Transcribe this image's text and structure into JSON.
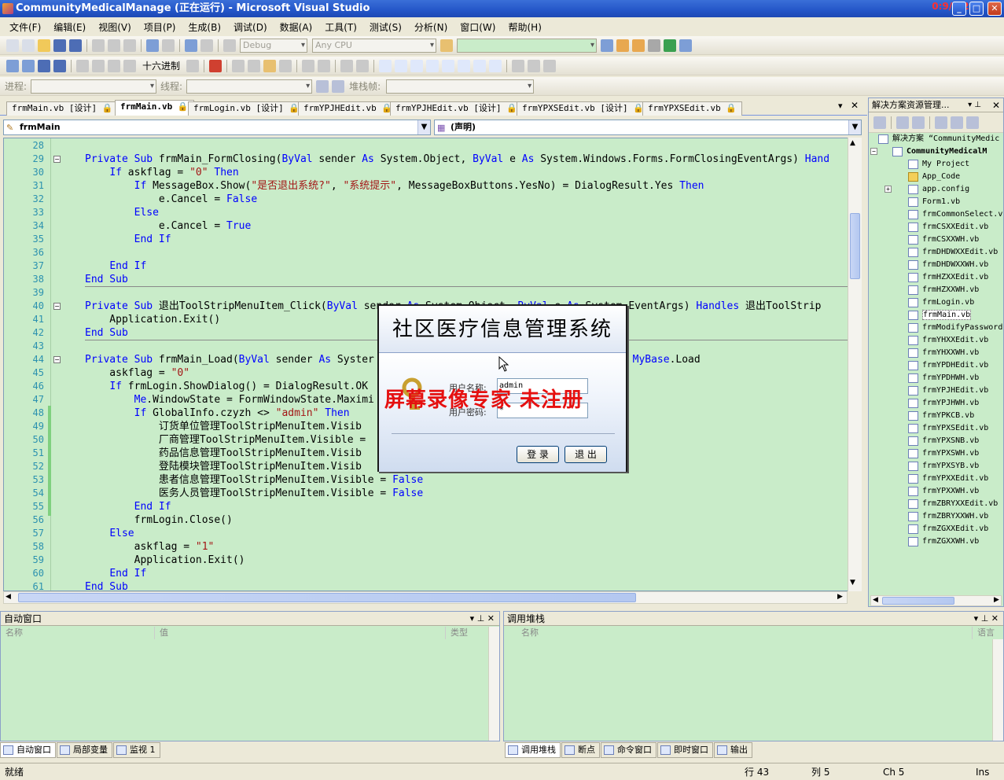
{
  "window": {
    "title": "CommunityMedicalManage (正在运行) - Microsoft Visual Studio",
    "timer": "0:9/2:29",
    "min": "_",
    "max": "□",
    "close": "✕"
  },
  "menu": [
    "文件(F)",
    "编辑(E)",
    "视图(V)",
    "项目(P)",
    "生成(B)",
    "调试(D)",
    "数据(A)",
    "工具(T)",
    "测试(S)",
    "分析(N)",
    "窗口(W)",
    "帮助(H)"
  ],
  "toolbar": {
    "config": "Debug",
    "platform": "Any CPU",
    "hex_label": "十六进制",
    "process_label": "进程:",
    "thread_label": "线程:",
    "stack_label": "堆栈帧:"
  },
  "tabs": [
    {
      "label": "frmMain.vb [设计]"
    },
    {
      "label": "frmMain.vb",
      "active": true
    },
    {
      "label": "frmLogin.vb [设计]"
    },
    {
      "label": "frmYPJHEdit.vb"
    },
    {
      "label": "frmYPJHEdit.vb [设计]"
    },
    {
      "label": "frmYPXSEdit.vb [设计]"
    },
    {
      "label": "frmYPXSEdit.vb"
    }
  ],
  "editor": {
    "class_combo": "frmMain",
    "member_combo": "(声明)",
    "lines": [
      {
        "n": "28",
        "html": ""
      },
      {
        "n": "29",
        "html": "<span class=\"kw\">Private Sub</span> frmMain_FormClosing(<span class=\"kw\">ByVal</span> sender <span class=\"kw\">As</span> System.Object, <span class=\"kw\">ByVal</span> e <span class=\"kw\">As</span> System.Windows.Forms.FormClosingEventArgs) <span class=\"kw\">Hand</span>"
      },
      {
        "n": "30",
        "html": "    <span class=\"kw\">If</span> askflag = <span class=\"str\">\"0\"</span> <span class=\"kw\">Then</span>"
      },
      {
        "n": "31",
        "html": "        <span class=\"kw\">If</span> MessageBox.Show(<span class=\"str\">\"是否退出系统?\"</span>, <span class=\"str\">\"系统提示\"</span>, MessageBoxButtons.YesNo) = DialogResult.Yes <span class=\"kw\">Then</span>"
      },
      {
        "n": "32",
        "html": "            e.Cancel = <span class=\"kw\">False</span>"
      },
      {
        "n": "33",
        "html": "        <span class=\"kw\">Else</span>"
      },
      {
        "n": "34",
        "html": "            e.Cancel = <span class=\"kw\">True</span>"
      },
      {
        "n": "35",
        "html": "        <span class=\"kw\">End If</span>"
      },
      {
        "n": "36",
        "html": ""
      },
      {
        "n": "37",
        "html": "    <span class=\"kw\">End If</span>"
      },
      {
        "n": "38",
        "html": "<span class=\"kw\">End Sub</span>"
      },
      {
        "n": "39",
        "html": ""
      },
      {
        "n": "40",
        "html": "<span class=\"kw\">Private Sub</span> 退出ToolStripMenuItem_Click(<span class=\"kw\">ByVal</span> sender <span class=\"kw\">As</span> System.Object, <span class=\"kw\">ByVal</span> e <span class=\"kw\">As</span> System.EventArgs) <span class=\"kw\">Handles</span> 退出ToolStrip"
      },
      {
        "n": "41",
        "html": "    Application.Exit()"
      },
      {
        "n": "42",
        "html": "<span class=\"kw\">End Sub</span>"
      },
      {
        "n": "43",
        "html": ""
      },
      {
        "n": "44",
        "html": "<span class=\"kw\">Private Sub</span> frmMain_Load(<span class=\"kw\">ByVal</span> sender <span class=\"kw\">As</span> Syster                                   <span class=\"kw\">andles MyBase</span>.Load"
      },
      {
        "n": "45",
        "html": "    askflag = <span class=\"str\">\"0\"</span>"
      },
      {
        "n": "46",
        "html": "    <span class=\"kw\">If</span> frmLogin.ShowDialog() = DialogResult.OK"
      },
      {
        "n": "47",
        "html": "        <span class=\"kw\">Me</span>.WindowState = FormWindowState.Maximi"
      },
      {
        "n": "48",
        "html": "        <span class=\"kw\">If</span> GlobalInfo.czyzh &lt;&gt; <span class=\"str\">\"admin\"</span> <span class=\"kw\">Then</span>"
      },
      {
        "n": "49",
        "html": "            订货单位管理ToolStripMenuItem.Visib"
      },
      {
        "n": "50",
        "html": "            厂商管理ToolStripMenuItem.Visible ="
      },
      {
        "n": "51",
        "html": "            药品信息管理ToolStripMenuItem.Visib"
      },
      {
        "n": "52",
        "html": "            登陆模块管理ToolStripMenuItem.Visib"
      },
      {
        "n": "53",
        "html": "            患者信息管理ToolStripMenuItem.Visible = <span class=\"kw\">False</span>"
      },
      {
        "n": "54",
        "html": "            医务人员管理ToolStripMenuItem.Visible = <span class=\"kw\">False</span>"
      },
      {
        "n": "55",
        "html": "        <span class=\"kw\">End If</span>"
      },
      {
        "n": "56",
        "html": "        frmLogin.Close()"
      },
      {
        "n": "57",
        "html": "    <span class=\"kw\">Else</span>"
      },
      {
        "n": "58",
        "html": "        askflag = <span class=\"str\">\"1\"</span>"
      },
      {
        "n": "59",
        "html": "        Application.Exit()"
      },
      {
        "n": "60",
        "html": "    <span class=\"kw\">End If</span>"
      },
      {
        "n": "61",
        "html": "<span class=\"kw\">End Sub</span>"
      }
    ]
  },
  "solution": {
    "title": "解决方案资源管理...",
    "items": [
      {
        "label": "解决方案 “CommunityMedic",
        "level": 0,
        "type": "solution"
      },
      {
        "label": "CommunityMedicalM",
        "level": 1,
        "type": "project",
        "bold": true
      },
      {
        "label": "My Project",
        "level": 2,
        "type": "file"
      },
      {
        "label": "App_Code",
        "level": 2,
        "type": "folder"
      },
      {
        "label": "app.config",
        "level": 2,
        "type": "file"
      },
      {
        "label": "Form1.vb",
        "level": 2,
        "type": "file"
      },
      {
        "label": "frmCommonSelect.v",
        "level": 2,
        "type": "file"
      },
      {
        "label": "frmCSXXEdit.vb",
        "level": 2,
        "type": "file"
      },
      {
        "label": "frmCSXXWH.vb",
        "level": 2,
        "type": "file"
      },
      {
        "label": "frmDHDWXXEdit.vb",
        "level": 2,
        "type": "file"
      },
      {
        "label": "frmDHDWXXWH.vb",
        "level": 2,
        "type": "file"
      },
      {
        "label": "frmHZXXEdit.vb",
        "level": 2,
        "type": "file"
      },
      {
        "label": "frmHZXXWH.vb",
        "level": 2,
        "type": "file"
      },
      {
        "label": "frmLogin.vb",
        "level": 2,
        "type": "file"
      },
      {
        "label": "frmMain.vb",
        "level": 2,
        "type": "file",
        "selected": true
      },
      {
        "label": "frmModifyPassword",
        "level": 2,
        "type": "file"
      },
      {
        "label": "frmYHXXEdit.vb",
        "level": 2,
        "type": "file"
      },
      {
        "label": "frmYHXXWH.vb",
        "level": 2,
        "type": "file"
      },
      {
        "label": "frmYPDHEdit.vb",
        "level": 2,
        "type": "file"
      },
      {
        "label": "frmYPDHWH.vb",
        "level": 2,
        "type": "file"
      },
      {
        "label": "frmYPJHEdit.vb",
        "level": 2,
        "type": "file"
      },
      {
        "label": "frmYPJHWH.vb",
        "level": 2,
        "type": "file"
      },
      {
        "label": "frmYPKCB.vb",
        "level": 2,
        "type": "file"
      },
      {
        "label": "frmYPXSEdit.vb",
        "level": 2,
        "type": "file"
      },
      {
        "label": "frmYPXSNB.vb",
        "level": 2,
        "type": "file"
      },
      {
        "label": "frmYPXSWH.vb",
        "level": 2,
        "type": "file"
      },
      {
        "label": "frmYPXSYB.vb",
        "level": 2,
        "type": "file"
      },
      {
        "label": "frmYPXXEdit.vb",
        "level": 2,
        "type": "file"
      },
      {
        "label": "frmYPXXWH.vb",
        "level": 2,
        "type": "file"
      },
      {
        "label": "frmZBRYXXEdit.vb",
        "level": 2,
        "type": "file"
      },
      {
        "label": "frmZBRYXXWH.vb",
        "level": 2,
        "type": "file"
      },
      {
        "label": "frmZGXXEdit.vb",
        "level": 2,
        "type": "file"
      },
      {
        "label": "frmZGXXWH.vb",
        "level": 2,
        "type": "file"
      }
    ]
  },
  "auto_window": {
    "title": "自动窗口",
    "col_name": "名称",
    "col_value": "值",
    "col_type": "类型"
  },
  "callstack": {
    "title": "调用堆栈",
    "col_name": "名称",
    "col_lang": "语言"
  },
  "bottom_tabs_left": [
    {
      "label": "自动窗口",
      "active": true
    },
    {
      "label": "局部变量"
    },
    {
      "label": "监视 1"
    }
  ],
  "bottom_tabs_right": [
    {
      "label": "调用堆栈",
      "active": true
    },
    {
      "label": "断点"
    },
    {
      "label": "命令窗口"
    },
    {
      "label": "即时窗口"
    },
    {
      "label": "输出"
    }
  ],
  "status": {
    "ready": "就绪",
    "row": "行 43",
    "col": "列 5",
    "ch": "Ch 5",
    "ins": "Ins"
  },
  "dialog": {
    "title": "社区医疗信息管理系统",
    "user_label": "用户名称:",
    "user_value": "admin",
    "pwd_label": "用户密码:",
    "pwd_value": "*",
    "login_button": "登 录",
    "exit_button": "退 出"
  },
  "watermark": "屏幕录像专家 未注册"
}
